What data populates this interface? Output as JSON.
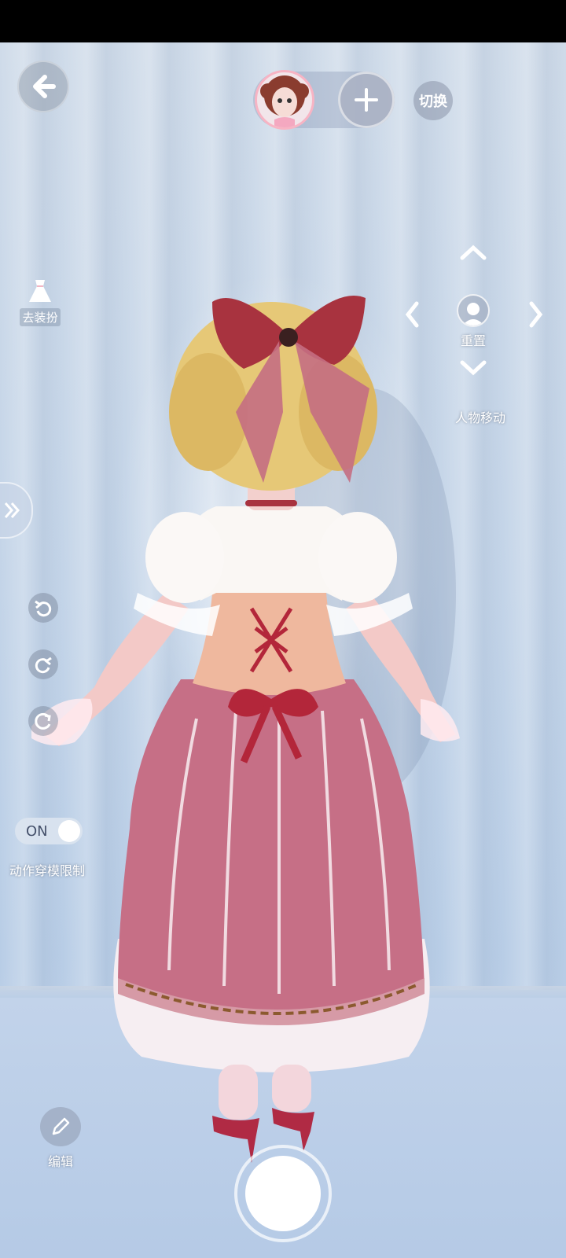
{
  "header": {
    "switch_label": "切换"
  },
  "left_panel": {
    "dress_up_label": "去装扮",
    "toggle_state": "ON",
    "toggle_label": "动作穿模限制"
  },
  "move_pad": {
    "reset_label": "重置",
    "move_label": "人物移动"
  },
  "bottom": {
    "edit_label": "编辑"
  },
  "icons": {
    "back": "back-arrow-icon",
    "add": "plus-icon",
    "dress": "dress-icon",
    "expand": "double-chevron-right-icon",
    "undo": "undo-icon",
    "redo": "redo-icon",
    "rotate": "rotate-icon",
    "up": "chevron-up-icon",
    "down": "chevron-down-icon",
    "left": "chevron-left-icon",
    "right": "chevron-right-icon",
    "reset": "person-icon",
    "edit": "pencil-icon"
  },
  "colors": {
    "curtain": "#cfdbe9",
    "dress_pink": "#c66f86",
    "bow_red": "#a8333f",
    "hair_blonde": "#e6c877"
  }
}
